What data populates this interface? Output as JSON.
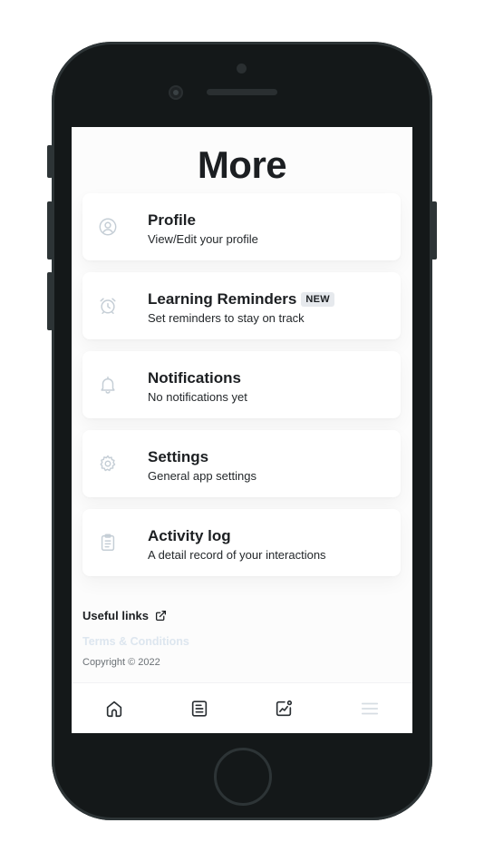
{
  "page": {
    "title": "More"
  },
  "menu": [
    {
      "title": "Profile",
      "subtitle": "View/Edit your profile",
      "icon": "user-circle-icon"
    },
    {
      "title": "Learning Reminders",
      "badge": "NEW",
      "subtitle": "Set reminders to stay on track",
      "icon": "alarm-clock-icon"
    },
    {
      "title": "Notifications",
      "subtitle": "No notifications yet",
      "icon": "bell-icon"
    },
    {
      "title": "Settings",
      "subtitle": "General app settings",
      "icon": "gear-icon"
    },
    {
      "title": "Activity log",
      "subtitle": "A detail record of your interactions",
      "icon": "clipboard-list-icon"
    }
  ],
  "footer": {
    "useful_links": "Useful links",
    "terms": "Terms & Conditions",
    "copyright": "Copyright © 2022"
  },
  "tabbar": {
    "tabs": [
      {
        "icon": "home-icon"
      },
      {
        "icon": "book-icon"
      },
      {
        "icon": "chart-icon"
      },
      {
        "icon": "menu-icon"
      }
    ]
  },
  "colors": {
    "text_primary": "#1c1f22",
    "icon_muted": "#c5ced6",
    "terms_link": "#dde6ef",
    "device_body": "#141819"
  }
}
